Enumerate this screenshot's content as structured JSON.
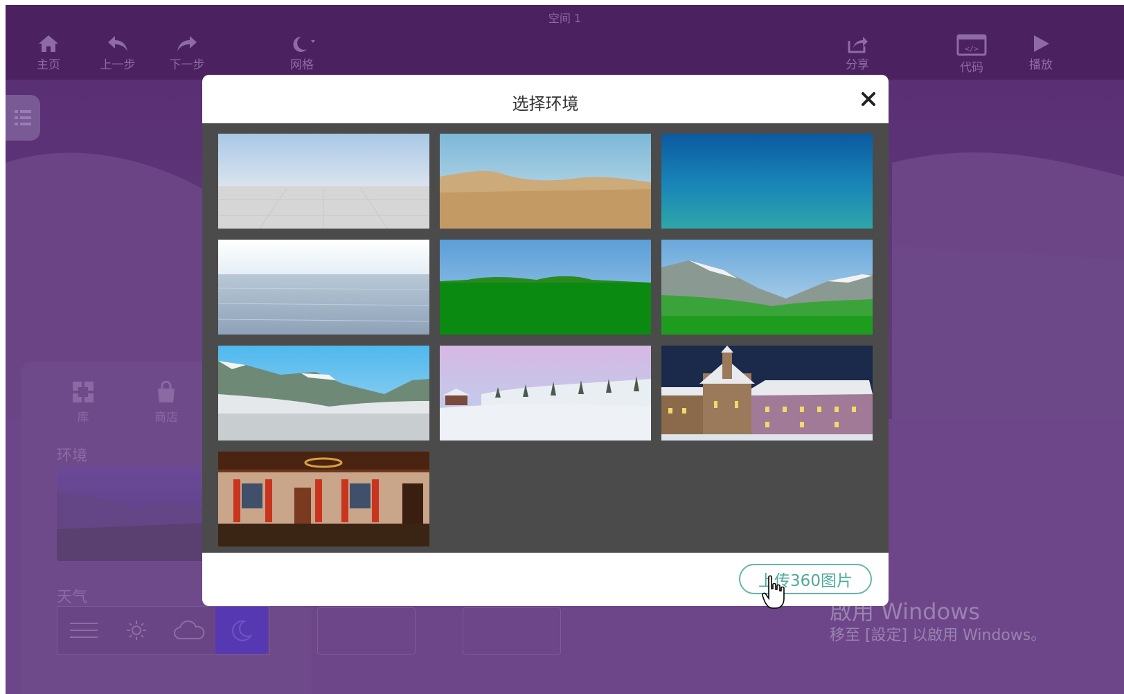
{
  "toolbar": {
    "space_title": "空间 1",
    "home": "主页",
    "undo": "上一步",
    "redo": "下一步",
    "grid": "网格",
    "share": "分享",
    "code": "代码",
    "play": "播放"
  },
  "panel": {
    "tab_library": "库",
    "tab_store": "商店",
    "environment_label": "环境",
    "weather_label": "天气",
    "weather_options": [
      "none-icon",
      "sun-icon",
      "cloud-icon",
      "moon-icon"
    ],
    "weather_selected": "moon-icon"
  },
  "modal": {
    "title": "选择环境",
    "upload_label": "上传360图片",
    "environments": [
      {
        "name": "grid-plain-environment"
      },
      {
        "name": "desert-environment"
      },
      {
        "name": "underwater-environment"
      },
      {
        "name": "ocean-environment"
      },
      {
        "name": "grassland-environment"
      },
      {
        "name": "green-mountains-environment"
      },
      {
        "name": "snowy-mountains-environment"
      },
      {
        "name": "snowy-forest-environment"
      },
      {
        "name": "winter-town-night-environment"
      },
      {
        "name": "room-interior-environment"
      }
    ]
  },
  "watermark": {
    "line1": "啟用 Windows",
    "line2": "移至 [設定] 以啟用 Windows。"
  },
  "colors": {
    "toolbar_bg": "#4b225f",
    "overlay_bg": "#6c4688",
    "accent": "#5fb7ad"
  }
}
